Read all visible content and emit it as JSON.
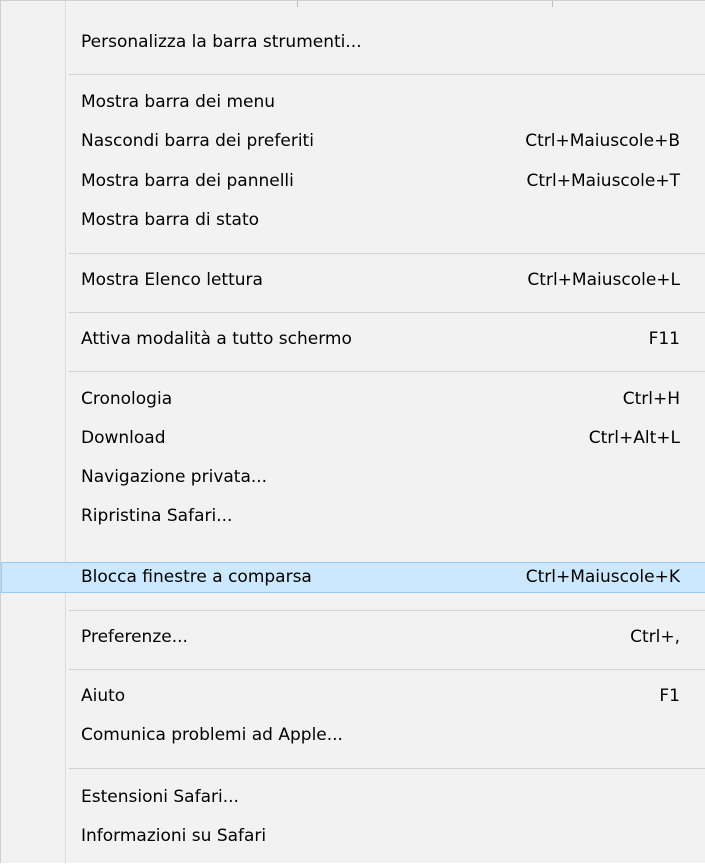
{
  "menu": {
    "groups": [
      [
        {
          "label": "Personalizza la barra strumenti...",
          "shortcut": ""
        }
      ],
      [
        {
          "label": "Mostra barra dei menu",
          "shortcut": ""
        },
        {
          "label": "Nascondi barra dei preferiti",
          "shortcut": "Ctrl+Maiuscole+B"
        },
        {
          "label": "Mostra barra dei pannelli",
          "shortcut": "Ctrl+Maiuscole+T"
        },
        {
          "label": "Mostra barra di stato",
          "shortcut": ""
        }
      ],
      [
        {
          "label": "Mostra Elenco lettura",
          "shortcut": "Ctrl+Maiuscole+L"
        }
      ],
      [
        {
          "label": "Attiva modalità a tutto schermo",
          "shortcut": "F11"
        }
      ],
      [
        {
          "label": "Cronologia",
          "shortcut": "Ctrl+H"
        },
        {
          "label": "Download",
          "shortcut": "Ctrl+Alt+L"
        },
        {
          "label": "Navigazione privata...",
          "shortcut": ""
        },
        {
          "label": "Ripristina Safari...",
          "shortcut": ""
        },
        {
          "label": "Blocca finestre a comparsa",
          "shortcut": "Ctrl+Maiuscole+K",
          "highlighted": true
        }
      ],
      [
        {
          "label": "Preferenze...",
          "shortcut": "Ctrl+,"
        }
      ],
      [
        {
          "label": "Aiuto",
          "shortcut": "F1"
        },
        {
          "label": "Comunica problemi ad Apple...",
          "shortcut": ""
        }
      ],
      [
        {
          "label": "Estensioni Safari...",
          "shortcut": ""
        },
        {
          "label": "Informazioni su Safari",
          "shortcut": ""
        }
      ]
    ],
    "colors": {
      "background": "#f2f2f2",
      "highlight": "#cce8ff",
      "highlight_border": "#99c9ef",
      "separator": "#d2d2d2"
    }
  }
}
